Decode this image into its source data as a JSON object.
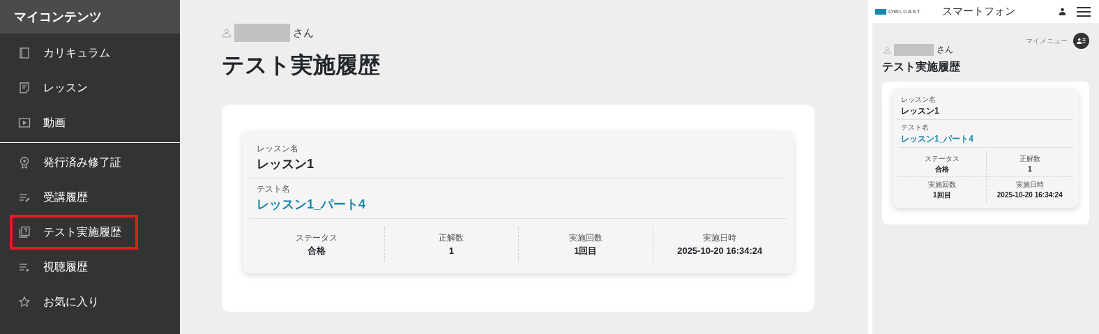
{
  "sidebar": {
    "title": "マイコンテンツ",
    "groups": [
      [
        {
          "kind": "book",
          "label": "カリキュラム",
          "selected": false
        },
        {
          "kind": "note",
          "label": "レッスン",
          "selected": false
        },
        {
          "kind": "video",
          "label": "動画",
          "selected": false
        }
      ],
      [
        {
          "kind": "medal",
          "label": "発行済み修了証",
          "selected": false
        },
        {
          "kind": "listpen",
          "label": "受講履歴",
          "selected": false
        },
        {
          "kind": "question",
          "label": "テスト実施履歴",
          "selected": true
        },
        {
          "kind": "listplay",
          "label": "視聴履歴",
          "selected": false
        },
        {
          "kind": "star",
          "label": "お気に入り",
          "selected": false
        }
      ]
    ]
  },
  "main": {
    "user_suffix": "さん",
    "heading": "テスト実施履歴",
    "record": {
      "lesson_label": "レッスン名",
      "lesson": "レッスン1",
      "test_label": "テスト名",
      "test": "レッスン1_パート4",
      "stats": [
        {
          "label": "ステータス",
          "value": "合格"
        },
        {
          "label": "正解数",
          "value": "1"
        },
        {
          "label": "実施回数",
          "value": "1回目"
        },
        {
          "label": "実施日時",
          "value": "2025-10-20 16:34:24"
        }
      ]
    }
  },
  "phone": {
    "logo": "OWLCAST",
    "title": "スマートフォン",
    "menu_label": "マイメニュー",
    "user_suffix": "さん",
    "heading": "テスト実施履歴",
    "record": {
      "lesson_label": "レッスン名",
      "lesson": "レッスン1",
      "test_label": "テスト名",
      "test": "レッスン1_パート4",
      "stats": [
        {
          "label": "ステータス",
          "value": "合格"
        },
        {
          "label": "正解数",
          "value": "1"
        },
        {
          "label": "実施回数",
          "value": "1回目"
        },
        {
          "label": "実施日時",
          "value": "2025-10-20 16:34:24"
        }
      ]
    }
  }
}
